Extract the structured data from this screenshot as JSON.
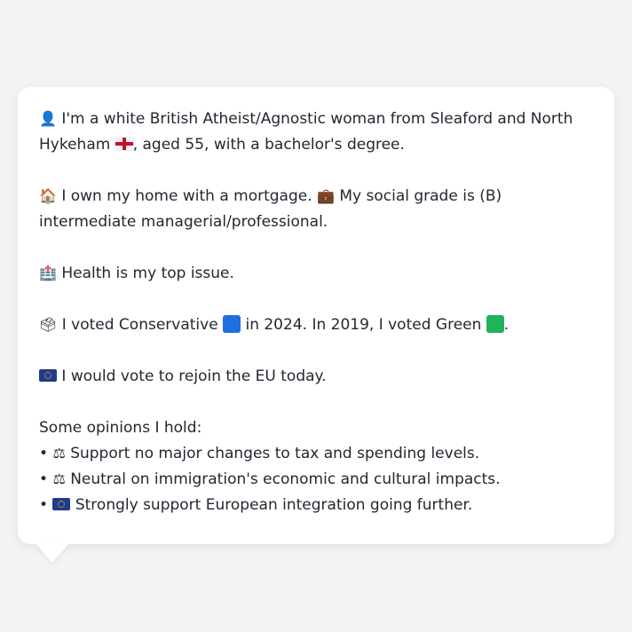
{
  "profile": {
    "intro": {
      "icon": "person-silhouette-icon",
      "text_before_flag": "I'm a white British Atheist/Agnostic woman from Sleaford and North Hykeham",
      "flag_icon": "england-flag-icon",
      "text_after_flag": ", aged 55, with a bachelor's degree."
    },
    "housing": {
      "icon": "house-icon",
      "text": "I own my home with a mortgage.",
      "briefcase_icon": "briefcase-icon",
      "text2": "My social grade is (B) intermediate managerial/professional."
    },
    "issue": {
      "icon": "hospital-icon",
      "text": "Health is my top issue."
    },
    "vote": {
      "icon": "ballot-box-icon",
      "text1": "I voted Conservative",
      "conservative_color": "#1e6fe0",
      "text2": "in 2024. In 2019, I voted Green",
      "green_color": "#20b35a",
      "text3": "."
    },
    "eu": {
      "icon": "eu-flag-icon",
      "text": "I would vote to rejoin the EU today."
    },
    "opinions": {
      "heading": "Some opinions I hold:",
      "items": [
        {
          "bullet": "•",
          "icon": "balance-scale-icon",
          "text": "Support no major changes to tax and spending levels."
        },
        {
          "bullet": "•",
          "icon": "balance-scale-icon",
          "text": "Neutral on immigration's economic and cultural impacts."
        },
        {
          "bullet": "•",
          "icon": "eu-flag-icon",
          "text": "Strongly support European integration going further."
        }
      ]
    }
  }
}
